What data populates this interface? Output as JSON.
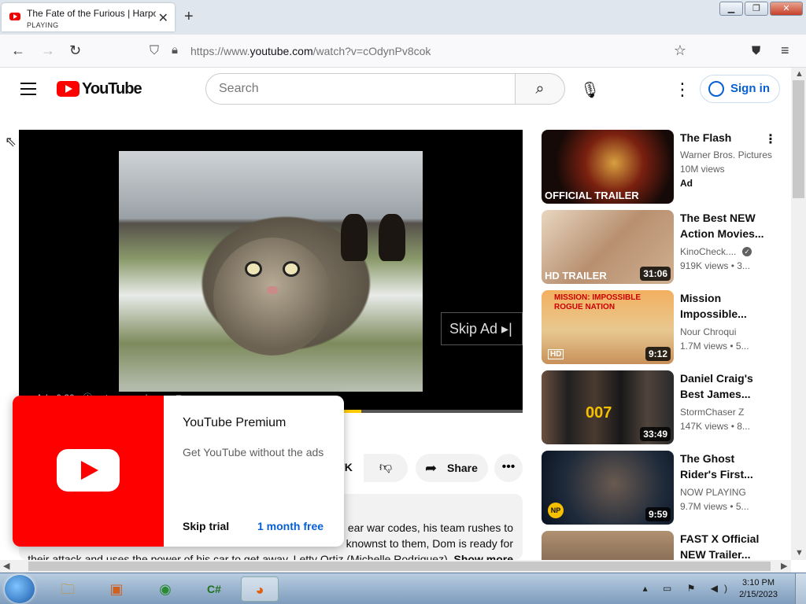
{
  "browser": {
    "tab_title": "The Fate of the Furious | Harpoon",
    "tab_status": "PLAYING",
    "url_prefix": "https://www.",
    "url_host": "youtube.com",
    "url_path": "/watch?v=cOdynPv8cok"
  },
  "yt": {
    "logo_text": "YouTube",
    "search_placeholder": "Search",
    "signin_label": "Sign in"
  },
  "player": {
    "skip_label": "Skip Ad ▸|",
    "ad_info": "Ad · 0:20 · ⓘ · store.google.com ⧉",
    "progress_fraction": 0.68
  },
  "promo": {
    "title": "YouTube Premium",
    "description": "Get YouTube without the ads",
    "skip_label": "Skip trial",
    "trial_label": "1 month free"
  },
  "actions": {
    "likes_label": "7K",
    "share_label": "Share"
  },
  "description": {
    "line1": "ear war codes, his team rushes to",
    "line2": "knownst to them, Dom is ready for",
    "line3": "their attack and uses the power of his car to get away. Letty Ortiz (Michelle Rodriguez)",
    "more": "Show more"
  },
  "recs": [
    {
      "title": "The Flash",
      "channel": "Warner Bros. Pictures",
      "views": "10M views",
      "badge": "Ad",
      "thumb_label": "OFFICIAL TRAILER",
      "duration": ""
    },
    {
      "title": "The Best NEW Action Movies...",
      "channel": "KinoCheck....",
      "views": "919K views • 3...",
      "badge": "",
      "thumb_label": "HD TRAILER",
      "duration": "31:06"
    },
    {
      "title": "Mission Impossible...",
      "channel": "Nour Chroqui",
      "views": "1.7M views • 5...",
      "badge": "",
      "thumb_label": "MISSION: IMPOSSIBLE ROGUE NATION",
      "duration": "9:12"
    },
    {
      "title": "Daniel Craig's Best James...",
      "channel": "StormChaser Z",
      "views": "147K views • 8...",
      "badge": "",
      "thumb_label": "007",
      "duration": "33:49"
    },
    {
      "title": "The Ghost Rider's First...",
      "channel": "NOW PLAYING",
      "views": "9.7M views • 5...",
      "badge": "",
      "thumb_label": "NP",
      "duration": "9:59"
    },
    {
      "title": "FAST X Official NEW Trailer...",
      "channel": "",
      "views": "",
      "badge": "",
      "thumb_label": "",
      "duration": ""
    }
  ],
  "taskbar": {
    "time": "3:10 PM",
    "date": "2/15/2023"
  },
  "colors": {
    "yt_red": "#ff0000",
    "link_blue": "#065fd4",
    "ad_progress": "#ffcc00"
  }
}
